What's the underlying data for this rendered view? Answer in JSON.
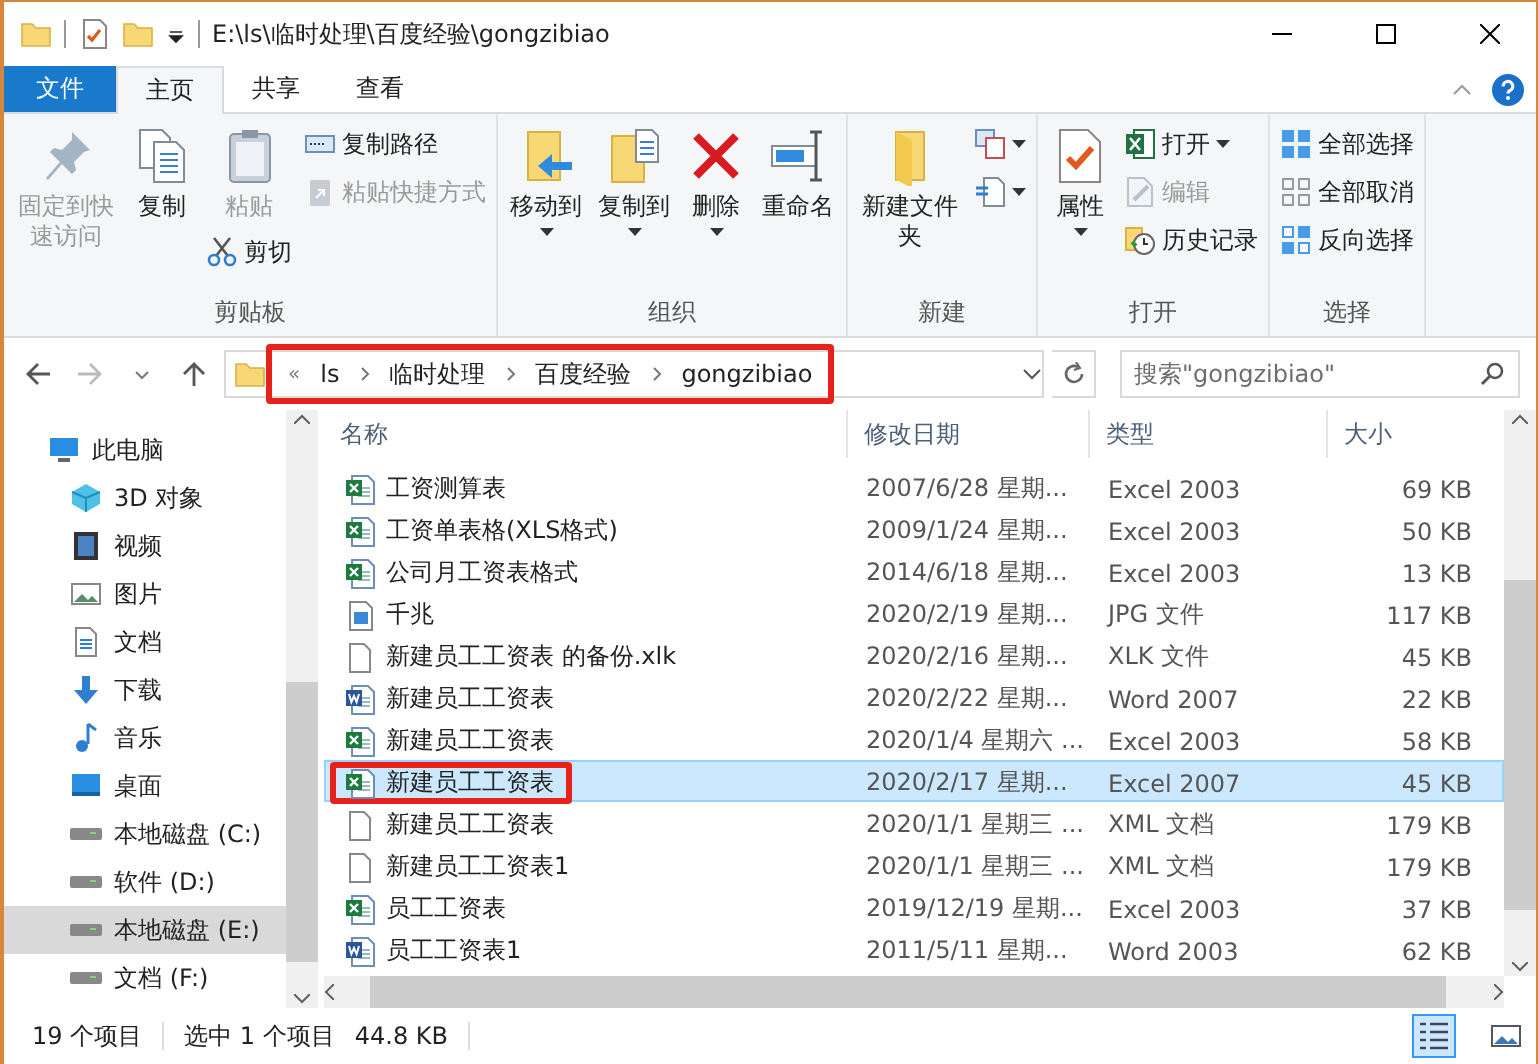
{
  "title_bar": {
    "path": "E:\\ls\\临时处理\\百度经验\\gongzibiao"
  },
  "ribbon_tabs": [
    {
      "label": "文件",
      "kind": "file",
      "selected": false
    },
    {
      "label": "主页",
      "kind": "tab",
      "selected": true
    },
    {
      "label": "共享",
      "kind": "tab",
      "selected": false
    },
    {
      "label": "查看",
      "kind": "tab",
      "selected": false
    }
  ],
  "ribbon_groups": [
    {
      "label": "剪贴板",
      "columns": [
        [
          {
            "label": "固定到快速访问",
            "kind": "large",
            "disabled": true
          }
        ],
        [
          {
            "label": "复制",
            "kind": "large",
            "disabled": false
          }
        ],
        [
          {
            "label": "粘贴",
            "kind": "large",
            "disabled": true
          },
          {
            "label": "剪切",
            "kind": "small",
            "disabled": false
          }
        ],
        [
          {
            "label": "复制路径",
            "kind": "small",
            "disabled": false
          },
          {
            "label": "粘贴快捷方式",
            "kind": "small",
            "disabled": true
          }
        ]
      ]
    },
    {
      "label": "组织",
      "columns": [
        [
          {
            "label": "移动到",
            "kind": "large",
            "dropdown": true
          }
        ],
        [
          {
            "label": "复制到",
            "kind": "large",
            "dropdown": true
          }
        ],
        [
          {
            "label": "删除",
            "kind": "large",
            "dropdown": true
          }
        ],
        [
          {
            "label": "重命名",
            "kind": "large"
          }
        ]
      ]
    },
    {
      "label": "新建",
      "columns": [
        [
          {
            "label": "新建文件夹",
            "kind": "large"
          }
        ],
        [
          {
            "kind": "small",
            "dropdown": true
          },
          {
            "kind": "small",
            "dropdown": true
          }
        ]
      ]
    },
    {
      "label": "打开",
      "columns": [
        [
          {
            "label": "属性",
            "kind": "large",
            "dropdown": true
          }
        ],
        [
          {
            "label": "打开",
            "kind": "small",
            "dropdown": true
          },
          {
            "label": "编辑",
            "kind": "small",
            "disabled": true
          },
          {
            "label": "历史记录",
            "kind": "small"
          }
        ]
      ]
    },
    {
      "label": "选择",
      "columns": [
        [
          {
            "label": "全部选择",
            "kind": "small"
          },
          {
            "label": "全部取消",
            "kind": "small"
          },
          {
            "label": "反向选择",
            "kind": "small"
          }
        ]
      ]
    }
  ],
  "address_bar": {
    "highlighted": true,
    "overflow": "«",
    "segments": [
      "ls",
      "临时处理",
      "百度经验",
      "gongzibiao"
    ]
  },
  "search": {
    "placeholder": "搜索\"gongzibiao\""
  },
  "navigation": [
    {
      "label": "此电脑",
      "selected": false,
      "children": [
        {
          "label": "3D 对象",
          "selected": false
        },
        {
          "label": "视频",
          "selected": false
        },
        {
          "label": "图片",
          "selected": false
        },
        {
          "label": "文档",
          "selected": false
        },
        {
          "label": "下载",
          "selected": false
        },
        {
          "label": "音乐",
          "selected": false
        },
        {
          "label": "桌面",
          "selected": false
        },
        {
          "label": "本地磁盘 (C:)",
          "selected": false
        },
        {
          "label": "软件 (D:)",
          "selected": false
        },
        {
          "label": "本地磁盘 (E:)",
          "selected": true
        },
        {
          "label": "文档 (F:)",
          "selected": false
        }
      ]
    }
  ],
  "columns": [
    "名称",
    "修改日期",
    "类型",
    "大小"
  ],
  "files": [
    {
      "name": "工资测算表",
      "modified": "2007/6/28 星期...",
      "type": "Excel 2003",
      "size": "69 KB",
      "kind": "excel",
      "selected": false,
      "highlighted": false
    },
    {
      "name": "工资单表格(XLS格式)",
      "modified": "2009/1/24 星期...",
      "type": "Excel 2003",
      "size": "50 KB",
      "kind": "excel",
      "selected": false,
      "highlighted": false
    },
    {
      "name": "公司月工资表格式",
      "modified": "2014/6/18 星期...",
      "type": "Excel 2003",
      "size": "13 KB",
      "kind": "excel",
      "selected": false,
      "highlighted": false
    },
    {
      "name": "千兆",
      "modified": "2020/2/19 星期...",
      "type": "JPG 文件",
      "size": "117 KB",
      "kind": "image",
      "selected": false,
      "highlighted": false
    },
    {
      "name": "新建员工工资表 的备份.xlk",
      "modified": "2020/2/16 星期...",
      "type": "XLK 文件",
      "size": "45 KB",
      "kind": "blank",
      "selected": false,
      "highlighted": false
    },
    {
      "name": "新建员工工资表",
      "modified": "2020/2/22 星期...",
      "type": "Word 2007",
      "size": "22 KB",
      "kind": "word",
      "selected": false,
      "highlighted": false
    },
    {
      "name": "新建员工工资表",
      "modified": "2020/1/4 星期六 ...",
      "type": "Excel 2003",
      "size": "58 KB",
      "kind": "excel",
      "selected": false,
      "highlighted": false
    },
    {
      "name": "新建员工工资表",
      "modified": "2020/2/17 星期...",
      "type": "Excel 2007",
      "size": "45 KB",
      "kind": "excel",
      "selected": true,
      "highlighted": true
    },
    {
      "name": "新建员工工资表",
      "modified": "2020/1/1 星期三 ...",
      "type": "XML 文档",
      "size": "179 KB",
      "kind": "blank",
      "selected": false,
      "highlighted": false
    },
    {
      "name": "新建员工工资表1",
      "modified": "2020/1/1 星期三 ...",
      "type": "XML 文档",
      "size": "179 KB",
      "kind": "blank",
      "selected": false,
      "highlighted": false
    },
    {
      "name": "员工工资表",
      "modified": "2019/12/19 星期...",
      "type": "Excel 2003",
      "size": "37 KB",
      "kind": "excel",
      "selected": false,
      "highlighted": false
    },
    {
      "name": "员工工资表1",
      "modified": "2011/5/11 星期...",
      "type": "Word 2003",
      "size": "62 KB",
      "kind": "word",
      "selected": false,
      "highlighted": false
    }
  ],
  "status_bar": {
    "count": "19 个项目",
    "selection": "选中 1 个项目",
    "selection_size": "44.8 KB"
  },
  "view_buttons": [
    {
      "kind": "details",
      "selected": true
    },
    {
      "kind": "thumbnails",
      "selected": false
    }
  ]
}
